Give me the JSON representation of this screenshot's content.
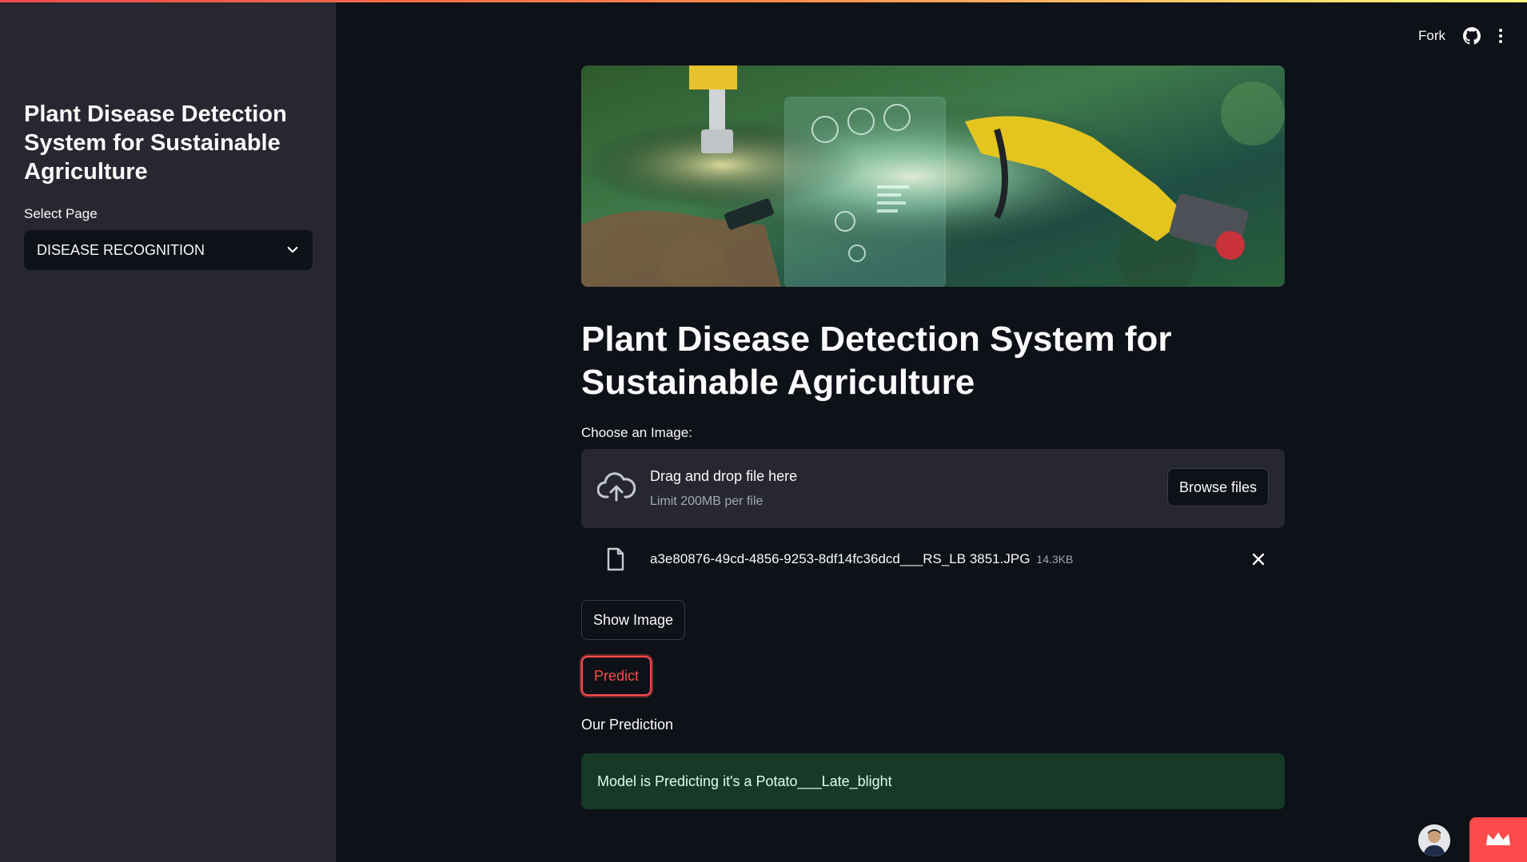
{
  "sidebar": {
    "title": "Plant Disease Detection System for Sustainable Agriculture",
    "select_label": "Select Page",
    "select_value": "DISEASE RECOGNITION"
  },
  "header": {
    "fork_label": "Fork",
    "github_icon": "github-icon",
    "menu_icon": "kebab-menu-icon"
  },
  "main": {
    "hero_image": "robotic-arms-plant-science-banner",
    "title": "Plant Disease Detection System for Sustainable Agriculture",
    "uploader": {
      "label": "Choose an Image:",
      "drop_text": "Drag and drop file here",
      "limit_text": "Limit 200MB per file",
      "browse_label": "Browse files",
      "file_name": "a3e80876-49cd-4856-9253-8df14fc36dcd___RS_LB 3851.JPG",
      "file_size": "14.3KB"
    },
    "show_image_label": "Show Image",
    "predict_label": "Predict",
    "prediction_label": "Our Prediction",
    "prediction_result": "Model is Predicting it's a Potato___Late_blight"
  },
  "colors": {
    "accent": "#ff4b4b",
    "background": "#0e1117",
    "sidebar": "#262730",
    "success_bg": "#173928"
  }
}
